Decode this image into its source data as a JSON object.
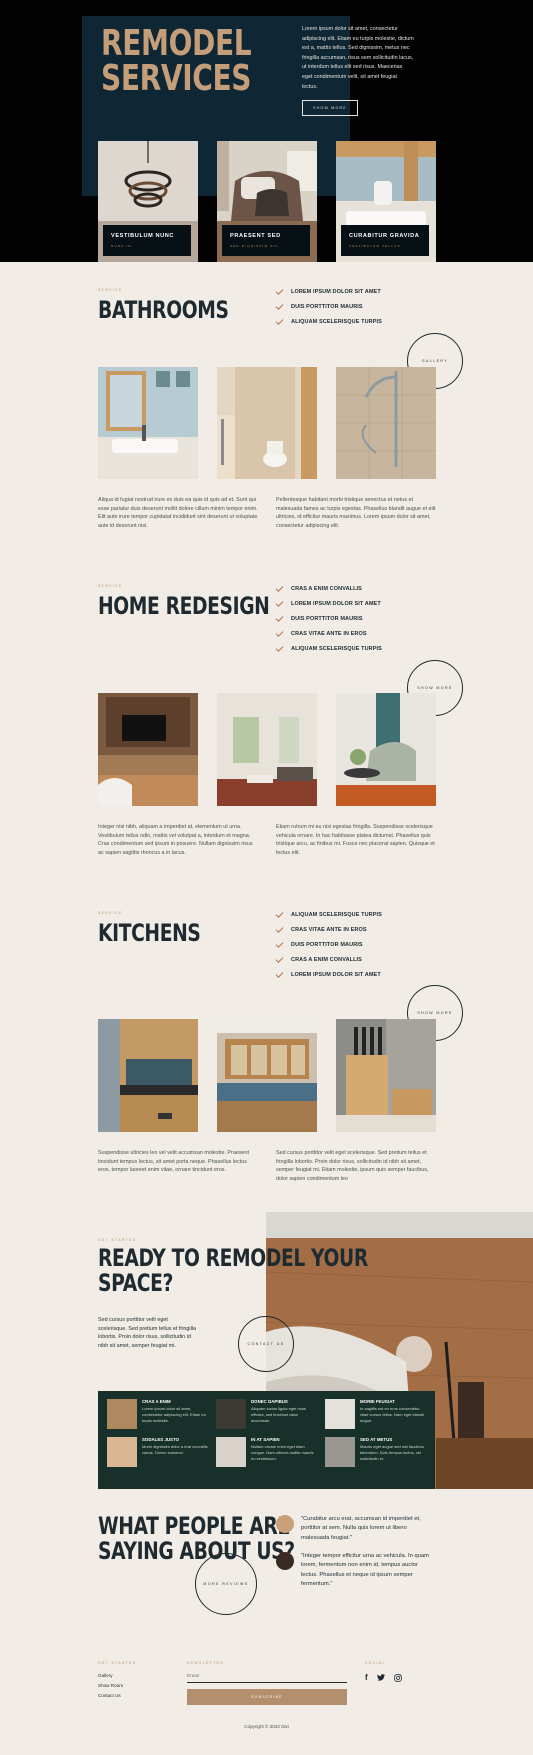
{
  "hero": {
    "title_line1": "REMODEL",
    "title_line2": "SERVICES",
    "text": "Lorem ipsum dolor sit amet, consectetur adipiscing elit. Etiam eu turpis molestie, dictum est a, mattis tellus. Sed dignissim, metus nec fringilla accumsan, risus sem sollicitudin lacus, ut interdum tellus elit sed risus. Maecenas eget condimentum velit, sit amet feugiat lectus.",
    "button": "SHOW MORE",
    "cards": [
      {
        "title": "VESTIBULUM NUNC",
        "sub": "NUNC ID"
      },
      {
        "title": "PRAESENT SED",
        "sub": "SED DIGNISSIM DUI"
      },
      {
        "title": "CURABITUR GRAVIDA",
        "sub": "VESTIBULUM TELLUS"
      }
    ]
  },
  "bathrooms": {
    "eyebrow": "SERVICE",
    "title": "BATHROOMS",
    "checks": [
      "LOREM IPSUM DOLOR SIT AMET",
      "DUIS PORTTITOR MAURIS",
      "ALIQUAM SCELERISQUE TURPIS"
    ],
    "circle": "GALLERY",
    "p1": "Aliqua id fugiat nostrud irure ex duis ea quis id quis ad et. Sunt qui esse pariatur duis deserunt mollit dolore cillum minim tempor enim. Elit aute irure tempor cupidatat incididunt sint deserunt ut voluptate aute id deserunt nisi.",
    "p2": "Pellentesque habitant morbi tristique senectus et netus et malesuada fames ac turpis egestas. Phasellus blandit augue et elit ultricies, id efficitur mauris maximus. Lorem ipsum dolor sit amet, consectetur adipiscing elit."
  },
  "home": {
    "eyebrow": "SERVICE",
    "title": "HOME REDESIGN",
    "checks": [
      "CRAS A ENIM CONVALLIS",
      "LOREM IPSUM DOLOR SIT AMET",
      "DUIS PORTTITOR MAURIS",
      "CRAS VITAE ANTE IN EROS",
      "ALIQUAM SCELERISQUE TURPIS"
    ],
    "circle": "SHOW MORE",
    "p1": "Integer nisi nibh, aliquam a imperdiet at, elementum ut urna. Vestibulum tellus odio, mattis vel volutpat a, interdum et magna. Cras condimentum sed ipsum in posuere. Nullam dignissim risus ac sapien sagittis rhoncus a in lacus.",
    "p2": "Etiam rutrum mi eu nisi egestas fringilla. Suspendisse scelerisque vehicula ornare. In hac habitasse platea dictumst. Phasellus quis tristique arcu, ac finibus mi. Fusce nec placerat sapien. Quisque et lectus elit."
  },
  "kitchens": {
    "eyebrow": "SERVICE",
    "title": "KITCHENS",
    "checks": [
      "ALIQUAM SCELERISQUE TURPIS",
      "CRAS VITAE ANTE IN EROS",
      "DUIS PORTTITOR MAURIS",
      "CRAS A ENIM CONVALLIS",
      "LOREM IPSUM DOLOR SIT AMET"
    ],
    "circle": "SHOW MORE",
    "p1": "Suspendisse ultricies leo vel velit accumsan molestie. Praesent tincidunt tempus lectus, sit amet porta neque. Phasellus lectus eros, tempor laoreet enim vitae, ornare tincidunt eros.",
    "p2": "Sed cursus porttitor velit eget scelerisque. Sed pretium tellus et fringilla lobortis. Proin dolor risus, sollicitudin id nibh sit amet, semper feugiat mi. Etiam molestie, ipsum quis semper faucibus, dolor sapien condimentum leo"
  },
  "cta": {
    "eyebrow": "GET STARTED",
    "title_line1": "READY TO REMODEL YOUR",
    "title_line2": "SPACE?",
    "text": "Sed cursus porttitor velit eget scelerisque. Sed pretium tellus et fringilla lobortis. Proin dolor risus, sollicitudin id nibh sit amet, semper feugiat mi.",
    "circle": "CONTACT US",
    "items": [
      {
        "title": "CRAS A ENIM",
        "text": "Lorem ipsum dolor sit amet, consectetur adipiscing elit. Etiam eu turpis molestie."
      },
      {
        "title": "DONEC DAPIBUS",
        "text": "Aliquam luctus ligula eget risus efficitur, sed tincidunt diam accumsan."
      },
      {
        "title": "MORBI FEUGIAT",
        "text": "In sagittis est eu eros consectetur, vitae cursus tellus. Nam eget blandit augue."
      },
      {
        "title": "SODALES JUSTO",
        "text": "Morbi dignissim dolor a erat convallis varius. Donec euismod."
      },
      {
        "title": "IN AT SAPIEN",
        "text": "Nullam ornare enim eget diam congue. Nam ultrices mattis mauris eu vestibulum."
      },
      {
        "title": "SED AT METUS",
        "text": "Mauris eget augue sed nisl faucibus bibendum. Duis tempus lectus, vel sollicitudin et."
      }
    ]
  },
  "testimonials": {
    "title_line1": "WHAT PEOPLE ARE",
    "title_line2": "SAYING ABOUT US?",
    "circle": "MORE REVIEWS",
    "quotes": [
      "\"Curabitur arcu erat, accumsan id imperdiet et, porttitor at sem. Nulla quis lorem ut libero malesuada feugiat.\"",
      "\"Integer tempor efficitur urna ac vehicula. In quam lorem, fermentum non enim id, tempus auctor lectus. Phasellus et neque id ipsum semper fermentum.\""
    ]
  },
  "footer": {
    "col1_title": "GET STARTED",
    "links": [
      "Gallery",
      "Show Room",
      "Contact Us"
    ],
    "col2_title": "NEWSLETTER",
    "email_placeholder": "Email",
    "subscribe": "SUBSCRIBE",
    "col3_title": "SOCIAL",
    "copyright": "Copyright © 2022 Divi"
  },
  "colors": {
    "navy": "#0f2634",
    "accent": "#b48f6e",
    "dark_green": "#173029",
    "bg": "#f1ede6"
  }
}
